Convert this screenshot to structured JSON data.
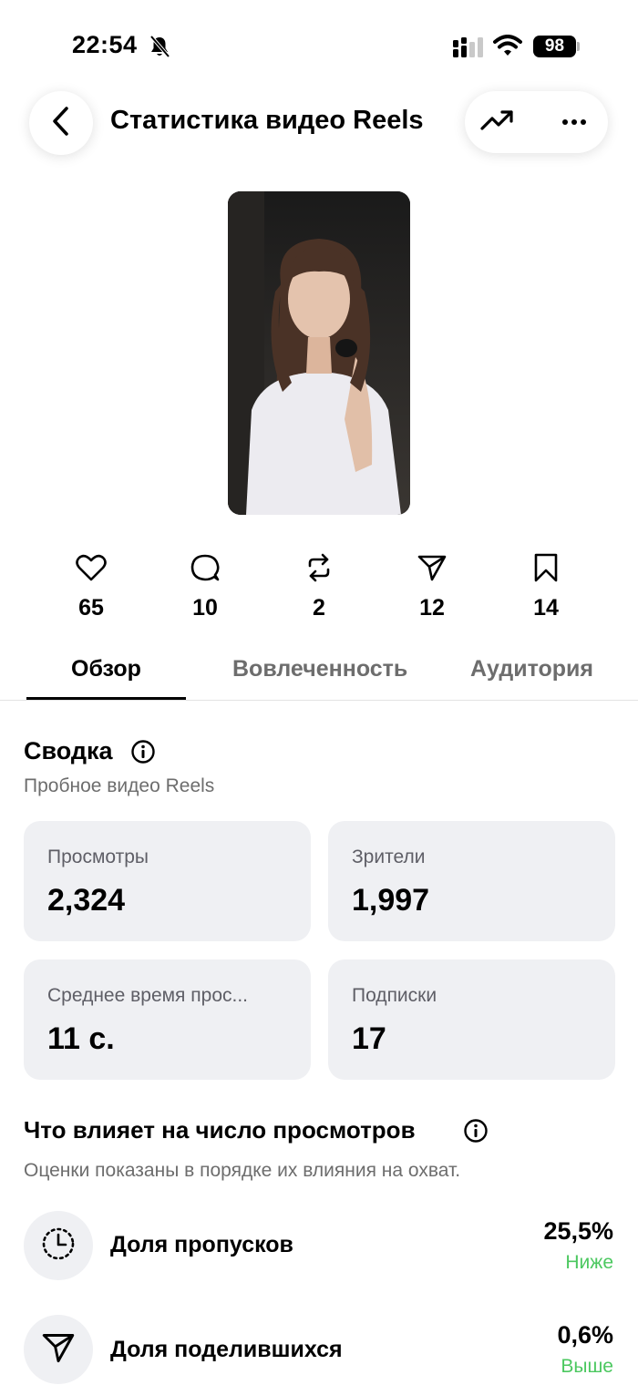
{
  "status_bar": {
    "time": "22:54",
    "battery": "98"
  },
  "header": {
    "title": "Статистика видео Reels"
  },
  "metrics": [
    {
      "icon": "heart-icon",
      "value": "65"
    },
    {
      "icon": "comment-icon",
      "value": "10"
    },
    {
      "icon": "repost-icon",
      "value": "2"
    },
    {
      "icon": "share-icon",
      "value": "12"
    },
    {
      "icon": "bookmark-icon",
      "value": "14"
    }
  ],
  "tabs": [
    {
      "label": "Обзор",
      "active": true
    },
    {
      "label": "Вовлеченность",
      "active": false
    },
    {
      "label": "Аудитория",
      "active": false
    }
  ],
  "summary": {
    "title": "Сводка",
    "subtitle": "Пробное видео Reels",
    "cards": [
      {
        "label": "Просмотры",
        "value": "2,324"
      },
      {
        "label": "Зрители",
        "value": "1,997"
      },
      {
        "label": "Среднее время прос...",
        "value": "11 с."
      },
      {
        "label": "Подписки",
        "value": "17"
      }
    ]
  },
  "factors": {
    "title": "Что влияет на число просмотров",
    "subtitle": "Оценки показаны в порядке их влияния на охват.",
    "items": [
      {
        "icon": "skip-rate-icon",
        "label": "Доля пропусков",
        "value": "25,5%",
        "status": "Ниже"
      },
      {
        "icon": "share-icon",
        "label": "Доля поделившихся",
        "value": "0,6%",
        "status": "Выше"
      }
    ]
  },
  "colors": {
    "positive": "#4cc860",
    "card_bg": "#eff0f3"
  }
}
